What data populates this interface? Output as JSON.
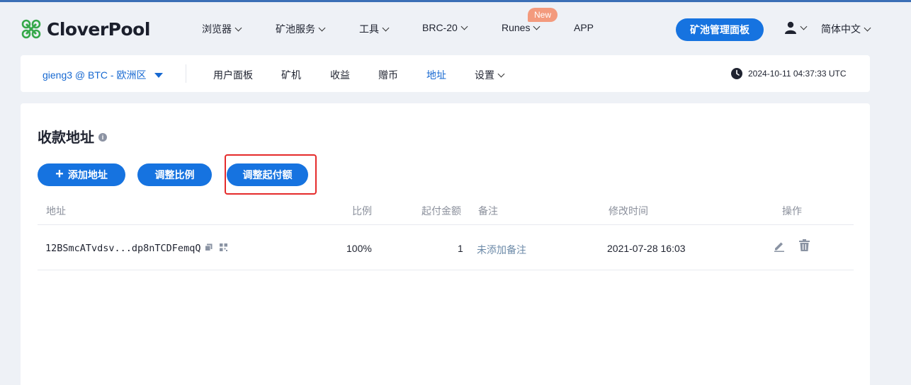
{
  "brand": {
    "name": "CloverPool"
  },
  "topnav": {
    "items": [
      {
        "label": "浏览器",
        "dropdown": true
      },
      {
        "label": "矿池服务",
        "dropdown": true
      },
      {
        "label": "工具",
        "dropdown": true
      },
      {
        "label": "BRC-20",
        "dropdown": true
      },
      {
        "label": "Runes",
        "dropdown": true,
        "badge": "New"
      },
      {
        "label": "APP",
        "dropdown": false
      }
    ],
    "dashboard_button": "矿池管理面板",
    "language": "简体中文"
  },
  "subnav": {
    "account": "gieng3 @ BTC - 欧洲区",
    "tabs": [
      "用户面板",
      "矿机",
      "收益",
      "赠币",
      "地址",
      "设置"
    ],
    "active_tab": "地址",
    "time": "2024-10-11 04:37:33 UTC"
  },
  "main": {
    "title": "收款地址",
    "buttons": {
      "add": "添加地址",
      "ratio": "调整比例",
      "threshold": "调整起付额"
    },
    "columns": [
      "地址",
      "比例",
      "起付金额",
      "备注",
      "修改时间",
      "操作"
    ],
    "rows": [
      {
        "address": "12BSmcATvdsv...dp8nTCDFemqQ",
        "ratio": "100%",
        "threshold": "1",
        "note": "未添加备注",
        "modified": "2021-07-28 16:03"
      }
    ]
  },
  "colors": {
    "primary": "#1673e0",
    "link": "#1668d1",
    "badge": "#f39a7d",
    "highlight": "#e52b2b"
  }
}
